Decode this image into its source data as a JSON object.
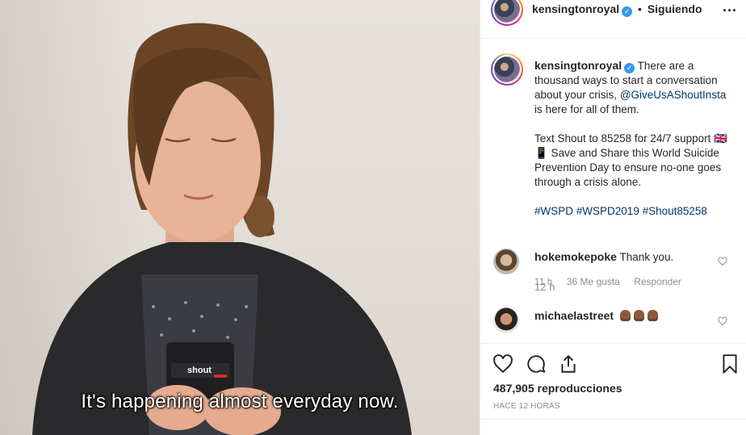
{
  "video": {
    "subtitle": "It's happening almost everyday now.",
    "phone_brand": "shout"
  },
  "header": {
    "username": "kensingtonroyal",
    "separator": "•",
    "follow_status": "Siguiendo",
    "more_label": "..."
  },
  "caption": {
    "username": "kensingtonroyal",
    "paragraph1_text": "There are a thousand ways to start a conversation about your crisis,",
    "mention": "@GiveUsAShoutInsta",
    "paragraph1_end": "is here for all of them.",
    "paragraph2": "Text Shout to 85258 for 24/7 support 🇬🇧📱 Save and Share this World Suicide Prevention Day to ensure no-one goes through a crisis alone.",
    "hashtags": [
      "#WSPD",
      "#WSPD2019",
      "#Shout85258"
    ],
    "time": "12 h"
  },
  "comments": [
    {
      "username": "hokemokepoke",
      "text": "Thank you.",
      "time": "11 h",
      "likes": "36 Me gusta",
      "reply_label": "Responder"
    },
    {
      "username": "michaelastreet",
      "text": "",
      "emoji": [
        "clapping-hands",
        "clapping-hands",
        "clapping-hands"
      ]
    }
  ],
  "actions": {
    "views": "487,905 reproducciones",
    "posted_ago": "HACE 12 HORAS"
  },
  "colors": {
    "link": "#00376b",
    "verified": "#3897f0",
    "muted": "#8e8e8e"
  }
}
